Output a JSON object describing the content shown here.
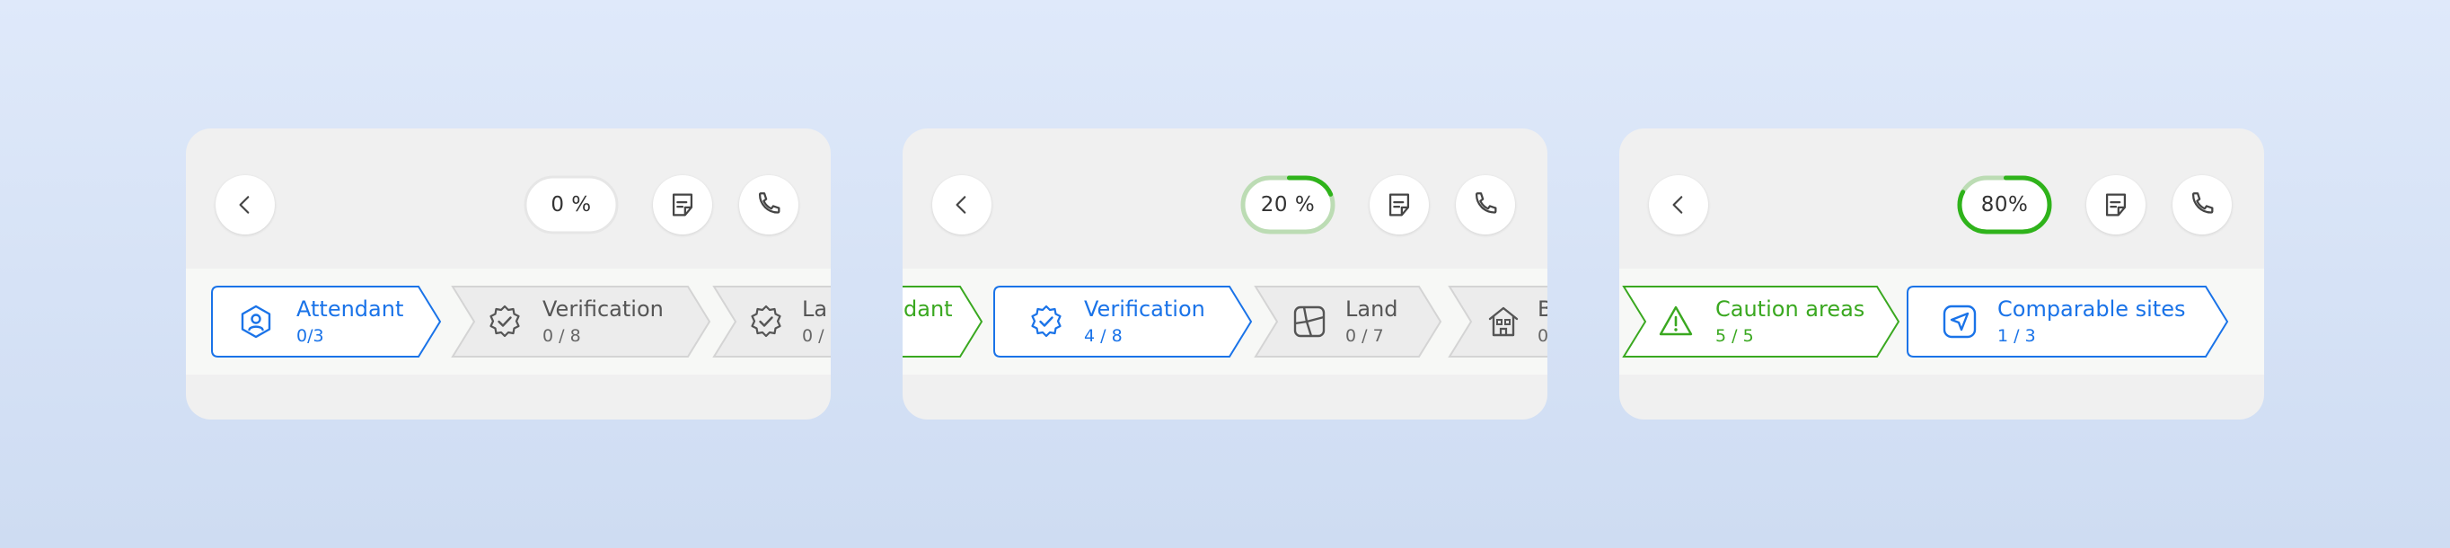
{
  "colors": {
    "blue": "#1a73e8",
    "blue_fill": "#ffffff",
    "green": "#3aa820",
    "gray_stroke": "#d4d4d4",
    "gray_fill": "#ececec",
    "ring_track": "#bcdcb4",
    "ring_fill": "#2fb31b"
  },
  "screens": [
    {
      "progress": {
        "label": "0 %",
        "value": 0
      },
      "icons": {
        "back": "chevron-left-icon",
        "doc": "note-document-icon",
        "phone": "phone-icon"
      },
      "steps": [
        {
          "title": "Attendant",
          "count": "0/3",
          "state": "active",
          "icon": "user-shield-icon"
        },
        {
          "title": "Verification",
          "count": "0 / 8",
          "state": "pending",
          "icon": "verified-badge-icon"
        },
        {
          "title": "La",
          "count": "0 /",
          "state": "pending",
          "icon": "verified-badge-icon"
        }
      ]
    },
    {
      "progress": {
        "label": "20 %",
        "value": 20
      },
      "icons": {
        "back": "chevron-left-icon",
        "doc": "note-document-icon",
        "phone": "phone-icon"
      },
      "steps": [
        {
          "title": "dant",
          "count": "",
          "state": "done",
          "icon": ""
        },
        {
          "title": "Verification",
          "count": "4 / 8",
          "state": "active",
          "icon": "verified-badge-icon"
        },
        {
          "title": "Land",
          "count": "0 / 7",
          "state": "pending",
          "icon": "land-plot-icon"
        },
        {
          "title": "B",
          "count": "0",
          "state": "pending",
          "icon": "house-icon"
        }
      ]
    },
    {
      "progress": {
        "label": "80%",
        "value": 80
      },
      "icons": {
        "back": "chevron-left-icon",
        "doc": "note-document-icon",
        "phone": "phone-icon"
      },
      "steps": [
        {
          "title": "Caution areas",
          "count": "5 / 5",
          "state": "done",
          "icon": "warning-triangle-icon"
        },
        {
          "title": "Comparable sites",
          "count": "1 / 3",
          "state": "active",
          "icon": "navigation-arrow-icon"
        }
      ]
    }
  ]
}
